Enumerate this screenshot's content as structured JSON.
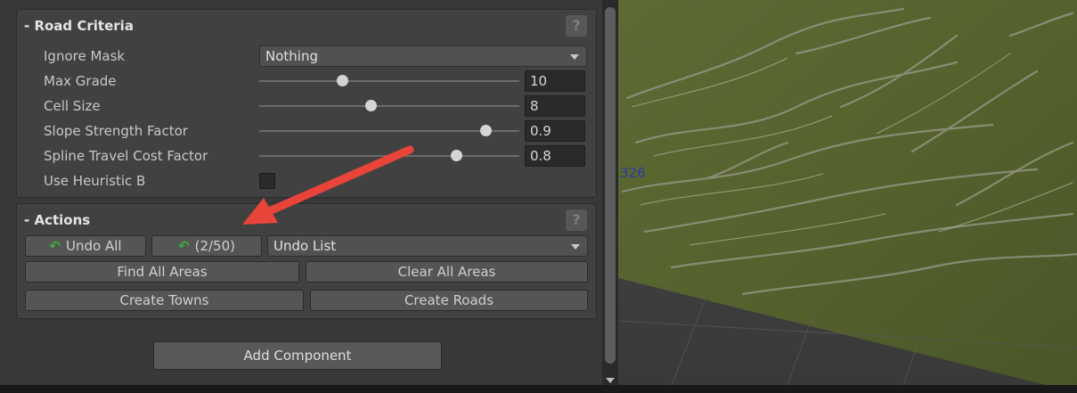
{
  "road_criteria": {
    "title": "- Road Criteria",
    "help_icon": "?",
    "ignore_mask": {
      "label": "Ignore Mask",
      "value": "Nothing"
    },
    "max_grade": {
      "label": "Max Grade",
      "value": "10",
      "slider_fraction": 0.32
    },
    "cell_size": {
      "label": "Cell Size",
      "value": "8",
      "slider_fraction": 0.43
    },
    "slope_strength_factor": {
      "label": "Slope Strength Factor",
      "value": "0.9",
      "slider_fraction": 0.87
    },
    "spline_travel_cost_factor": {
      "label": "Spline Travel Cost Factor",
      "value": "0.8",
      "slider_fraction": 0.76
    },
    "use_heuristic_b": {
      "label": "Use Heuristic B",
      "checked": false
    }
  },
  "actions": {
    "title": "- Actions",
    "help_icon": "?",
    "undo_all": "Undo All",
    "undo_count": "(2/50)",
    "undo_list": "Undo List",
    "find_all_areas": "Find All Areas",
    "clear_all_areas": "Clear All Areas",
    "create_towns": "Create Towns",
    "create_roads": "Create Roads",
    "undo_icon_name": "undo-arrow-icon",
    "undo_icon_color": "#3fae3f"
  },
  "add_component": "Add Component",
  "scene_view": {
    "label": "326",
    "label_color": "#2b3aa8"
  },
  "annotation_color": "#e8443a"
}
